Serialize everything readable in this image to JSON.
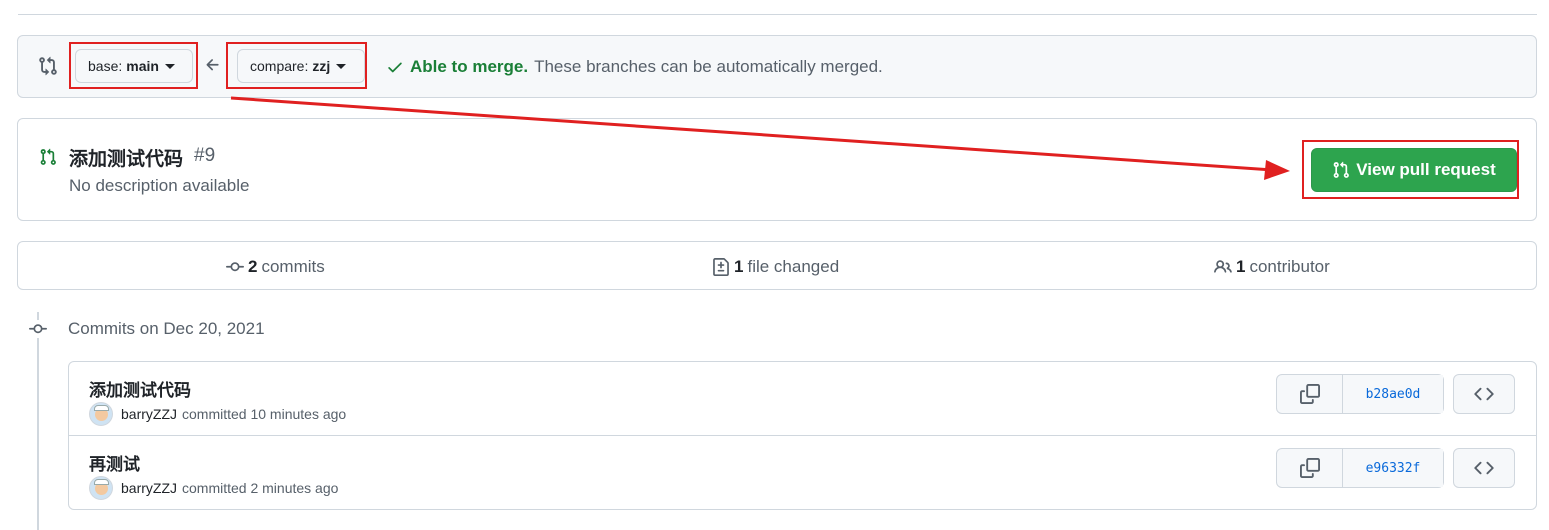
{
  "compare": {
    "base_key": "base:",
    "base_value": "main",
    "compare_key": "compare:",
    "compare_value": "zzj",
    "status_ok": "Able to merge.",
    "status_msg": "These branches can be automatically merged."
  },
  "pull_request": {
    "title": "添加测试代码",
    "number": "#9",
    "description": "No description available",
    "view_button": "View pull request"
  },
  "stats": {
    "commits_count": "2",
    "commits_label": "commits",
    "files_count": "1",
    "files_label": "file changed",
    "contributors_count": "1",
    "contributors_label": "contributor"
  },
  "timeline": {
    "date_heading": "Commits on Dec 20, 2021"
  },
  "commits": [
    {
      "message": "添加测试代码",
      "author": "barryZZJ",
      "action": "committed 10 minutes ago",
      "sha": "b28ae0d"
    },
    {
      "message": "再测试",
      "author": "barryZZJ",
      "action": "committed 2 minutes ago",
      "sha": "e96332f"
    }
  ],
  "colors": {
    "accent_green": "#2da44e",
    "annotation_red": "#e02020",
    "link_blue": "#0969da"
  },
  "icons": [
    "git-compare-icon",
    "arrow-left-icon",
    "check-icon",
    "git-pull-request-icon",
    "git-commit-icon",
    "file-diff-icon",
    "people-icon",
    "copy-icon",
    "code-icon"
  ]
}
